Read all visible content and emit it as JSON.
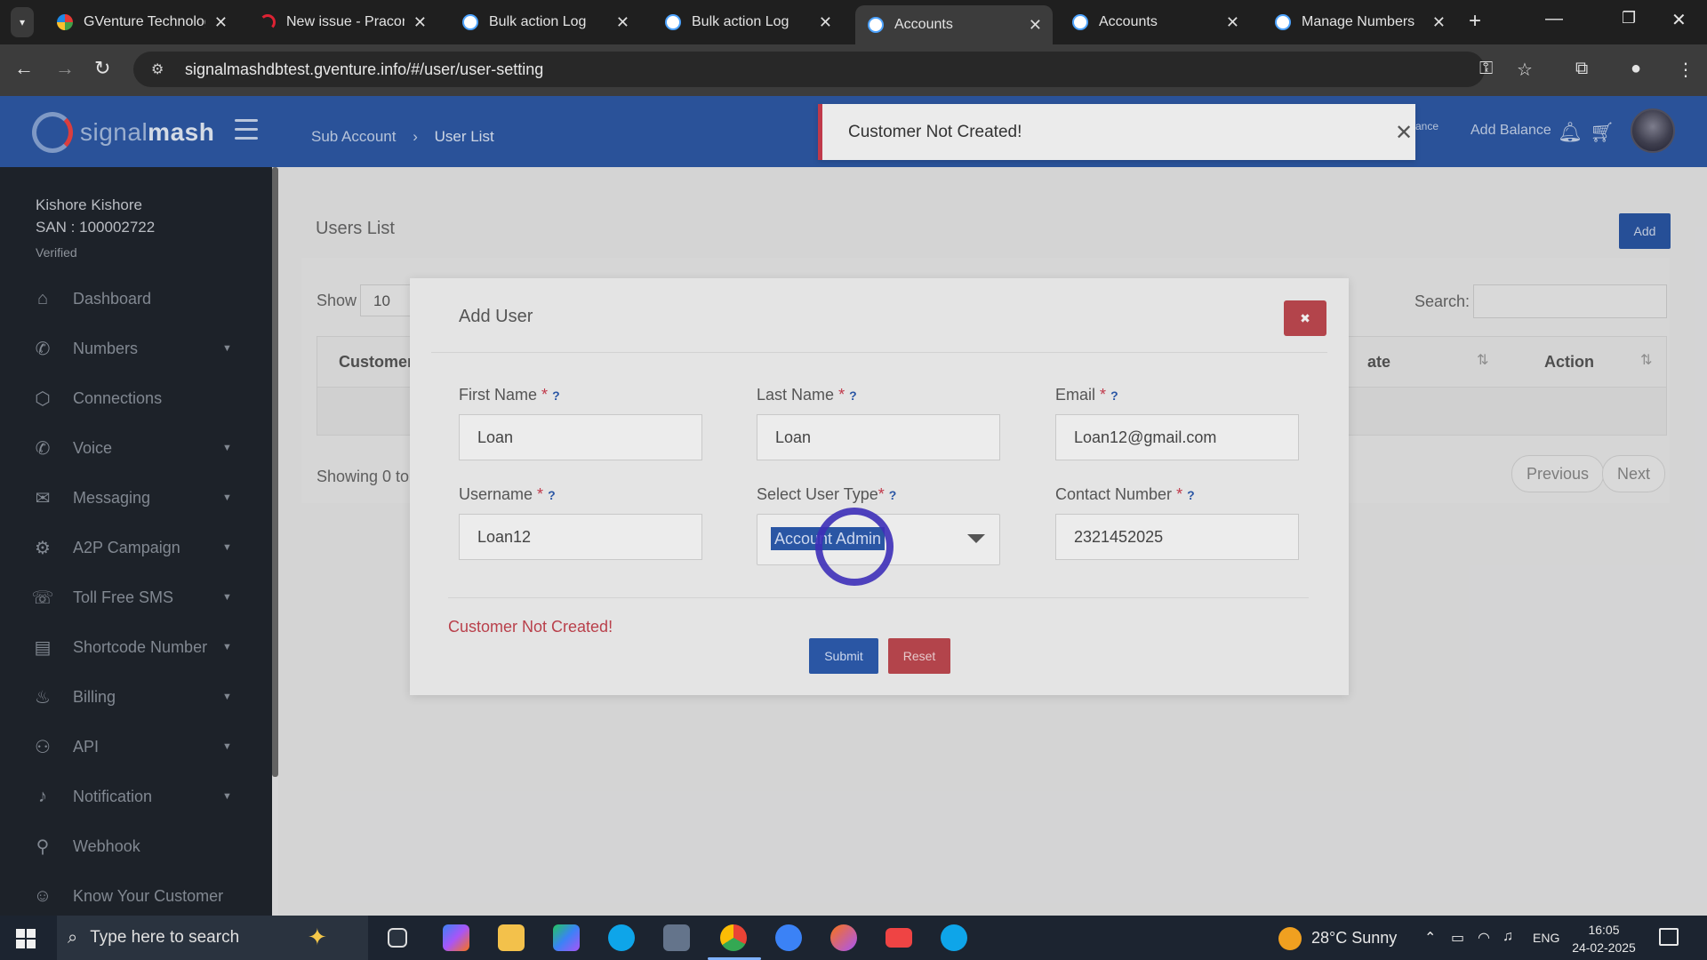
{
  "browser": {
    "tabs": [
      {
        "title": "GVenture Technology",
        "favicon": "gventure-icon"
      },
      {
        "title": "New issue - Pracona",
        "favicon": "phabricator-icon"
      },
      {
        "title": "Bulk action Log",
        "favicon": "signalmash-icon"
      },
      {
        "title": "Bulk action Log",
        "favicon": "signalmash-icon"
      },
      {
        "title": "Accounts",
        "favicon": "signalmash-icon",
        "active": true
      },
      {
        "title": "Accounts",
        "favicon": "signalmash-icon"
      },
      {
        "title": "Manage Numbers",
        "favicon": "signalmash-icon"
      }
    ],
    "url": "signalmashdbtest.gventure.info/#/user/user-setting"
  },
  "header": {
    "logo_prefix": "signal",
    "logo_suffix": "mash",
    "breadcrumb": {
      "parent": "Sub Account",
      "current": "User List"
    },
    "balance_peek": "ance",
    "add_balance": "Add Balance",
    "brand_color": "#2e5aa6"
  },
  "toast": {
    "message": "Customer Not Created!",
    "accent": "#c0394a"
  },
  "sidebar": {
    "user_name": "Kishore Kishore",
    "san": "SAN : 100002722",
    "status": "Verified",
    "items": [
      {
        "label": "Dashboard",
        "icon": "home-icon",
        "has_children": false
      },
      {
        "label": "Numbers",
        "icon": "phone-icon",
        "has_children": true
      },
      {
        "label": "Connections",
        "icon": "connections-icon",
        "has_children": false
      },
      {
        "label": "Voice",
        "icon": "phone-icon",
        "has_children": true
      },
      {
        "label": "Messaging",
        "icon": "envelope-icon",
        "has_children": true
      },
      {
        "label": "A2P Campaign",
        "icon": "gear-icon",
        "has_children": true
      },
      {
        "label": "Toll Free SMS",
        "icon": "phone-square-icon",
        "has_children": true
      },
      {
        "label": "Shortcode Number",
        "icon": "document-icon",
        "has_children": true
      },
      {
        "label": "Billing",
        "icon": "billing-icon",
        "has_children": true
      },
      {
        "label": "API",
        "icon": "users-icon",
        "has_children": true
      },
      {
        "label": "Notification",
        "icon": "bell-icon",
        "has_children": true
      },
      {
        "label": "Webhook",
        "icon": "webhook-icon",
        "has_children": false
      },
      {
        "label": "Know Your Customer",
        "icon": "user-check-icon",
        "has_children": false
      }
    ]
  },
  "users_list": {
    "title": "Users List",
    "add_label": "Add",
    "show_label": "Show",
    "page_size": "10",
    "search_label": "Search:",
    "columns": [
      "Customer",
      "ate",
      "Action"
    ],
    "showing_text": "Showing 0 to",
    "prev_label": "Previous",
    "next_label": "Next"
  },
  "modal": {
    "title": "Add User",
    "fields": {
      "first_name": {
        "label": "First Name",
        "value": "Loan"
      },
      "last_name": {
        "label": "Last Name",
        "value": "Loan"
      },
      "email": {
        "label": "Email",
        "value": "Loan12@gmail.com"
      },
      "username": {
        "label": "Username",
        "value": "Loan12"
      },
      "user_type": {
        "label": "Select User Type",
        "value": "Account Admin"
      },
      "contact": {
        "label": "Contact Number",
        "value": "2321452025"
      }
    },
    "required_mark": "*",
    "hint_mark": "?",
    "error": "Customer Not Created!",
    "submit_label": "Submit",
    "reset_label": "Reset"
  },
  "taskbar": {
    "search_placeholder": "Type here to search",
    "weather": "28°C  Sunny",
    "language": "ENG",
    "time": "16:05",
    "date": "24-02-2025"
  }
}
